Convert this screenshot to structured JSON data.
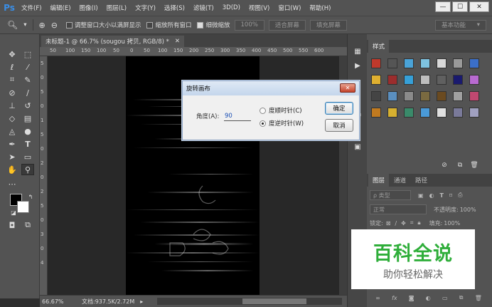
{
  "app": {
    "logo": "Ps"
  },
  "menubar": {
    "items": [
      "文件(F)",
      "编辑(E)",
      "图像(I)",
      "图层(L)",
      "文字(Y)",
      "选择(S)",
      "滤镜(T)",
      "3D(D)",
      "视图(V)",
      "窗口(W)",
      "帮助(H)"
    ],
    "minimize": "—",
    "restore": "☐",
    "close": "✕"
  },
  "options_bar": {
    "zoom_in": "⊕",
    "zoom_out": "⊖",
    "resize_windows": "调整窗口大小以满屏显示",
    "zoom_all": "缩放所有窗口",
    "scrubby_zoom": "细微缩放",
    "zoom_value": "100%",
    "fit_screen": "适合屏幕",
    "fill_screen": "填充屏幕",
    "workspace": "基本功能"
  },
  "document": {
    "tab_title": "未标题-1 @ 66.7% (sougou  拷贝, RGB/8) *",
    "tab_close": "✕",
    "status_zoom": "66.67%",
    "status_doc": "文档:937.5K/2.72M"
  },
  "rulers": {
    "h": [
      "50",
      "100",
      "150",
      "100",
      "50",
      "0",
      "50",
      "100",
      "150",
      "200",
      "250",
      "300",
      "350",
      "400",
      "450",
      "500",
      "550",
      "600"
    ],
    "v": [
      "5",
      "0",
      "5",
      "0",
      "1",
      "5",
      "0",
      "2",
      "0",
      "2",
      "5",
      "0",
      "3",
      "0",
      "4"
    ]
  },
  "dialog": {
    "title": "旋转画布",
    "close": "✕",
    "angle_label": "角度(A):",
    "angle_value": "90",
    "cw_label": "度顺时针(C)",
    "ccw_label": "度逆时针(W)",
    "selected": "ccw",
    "ok": "确定",
    "cancel": "取消"
  },
  "swatches_panel": {
    "tab": "样式",
    "colors": [
      "#c0392b",
      "#555555",
      "#4aa3d8",
      "#7ec3e0",
      "#d8d8d8",
      "#9a9a9a",
      "#3b6fc9",
      "#e0b030",
      "#9b2d2d",
      "#36a0d8",
      "#bdbdbd",
      "#606060",
      "#1a1a6e",
      "#b86ad0",
      "#444444",
      "#5a8fc0",
      "#8a8a8a",
      "#7a6a40",
      "#6a4a20",
      "#a0a0a0",
      "#c04870",
      "#c07a20",
      "#d6b030",
      "#3a8a6a",
      "#4a9ad8",
      "#e0e0e0",
      "#7a7a9a",
      "#a0a0c0"
    ]
  },
  "layers_panel": {
    "tabs": [
      "图层",
      "通道",
      "路径"
    ],
    "filter": "ρ 类型",
    "blend_mode": "正常",
    "opacity_label": "不透明度:",
    "opacity_value": "100%",
    "lock_label": "锁定:",
    "fill_label": "填充:",
    "fill_value": "100%"
  },
  "watermark": {
    "title": "百科全说",
    "subtitle": "助你轻松解决"
  }
}
